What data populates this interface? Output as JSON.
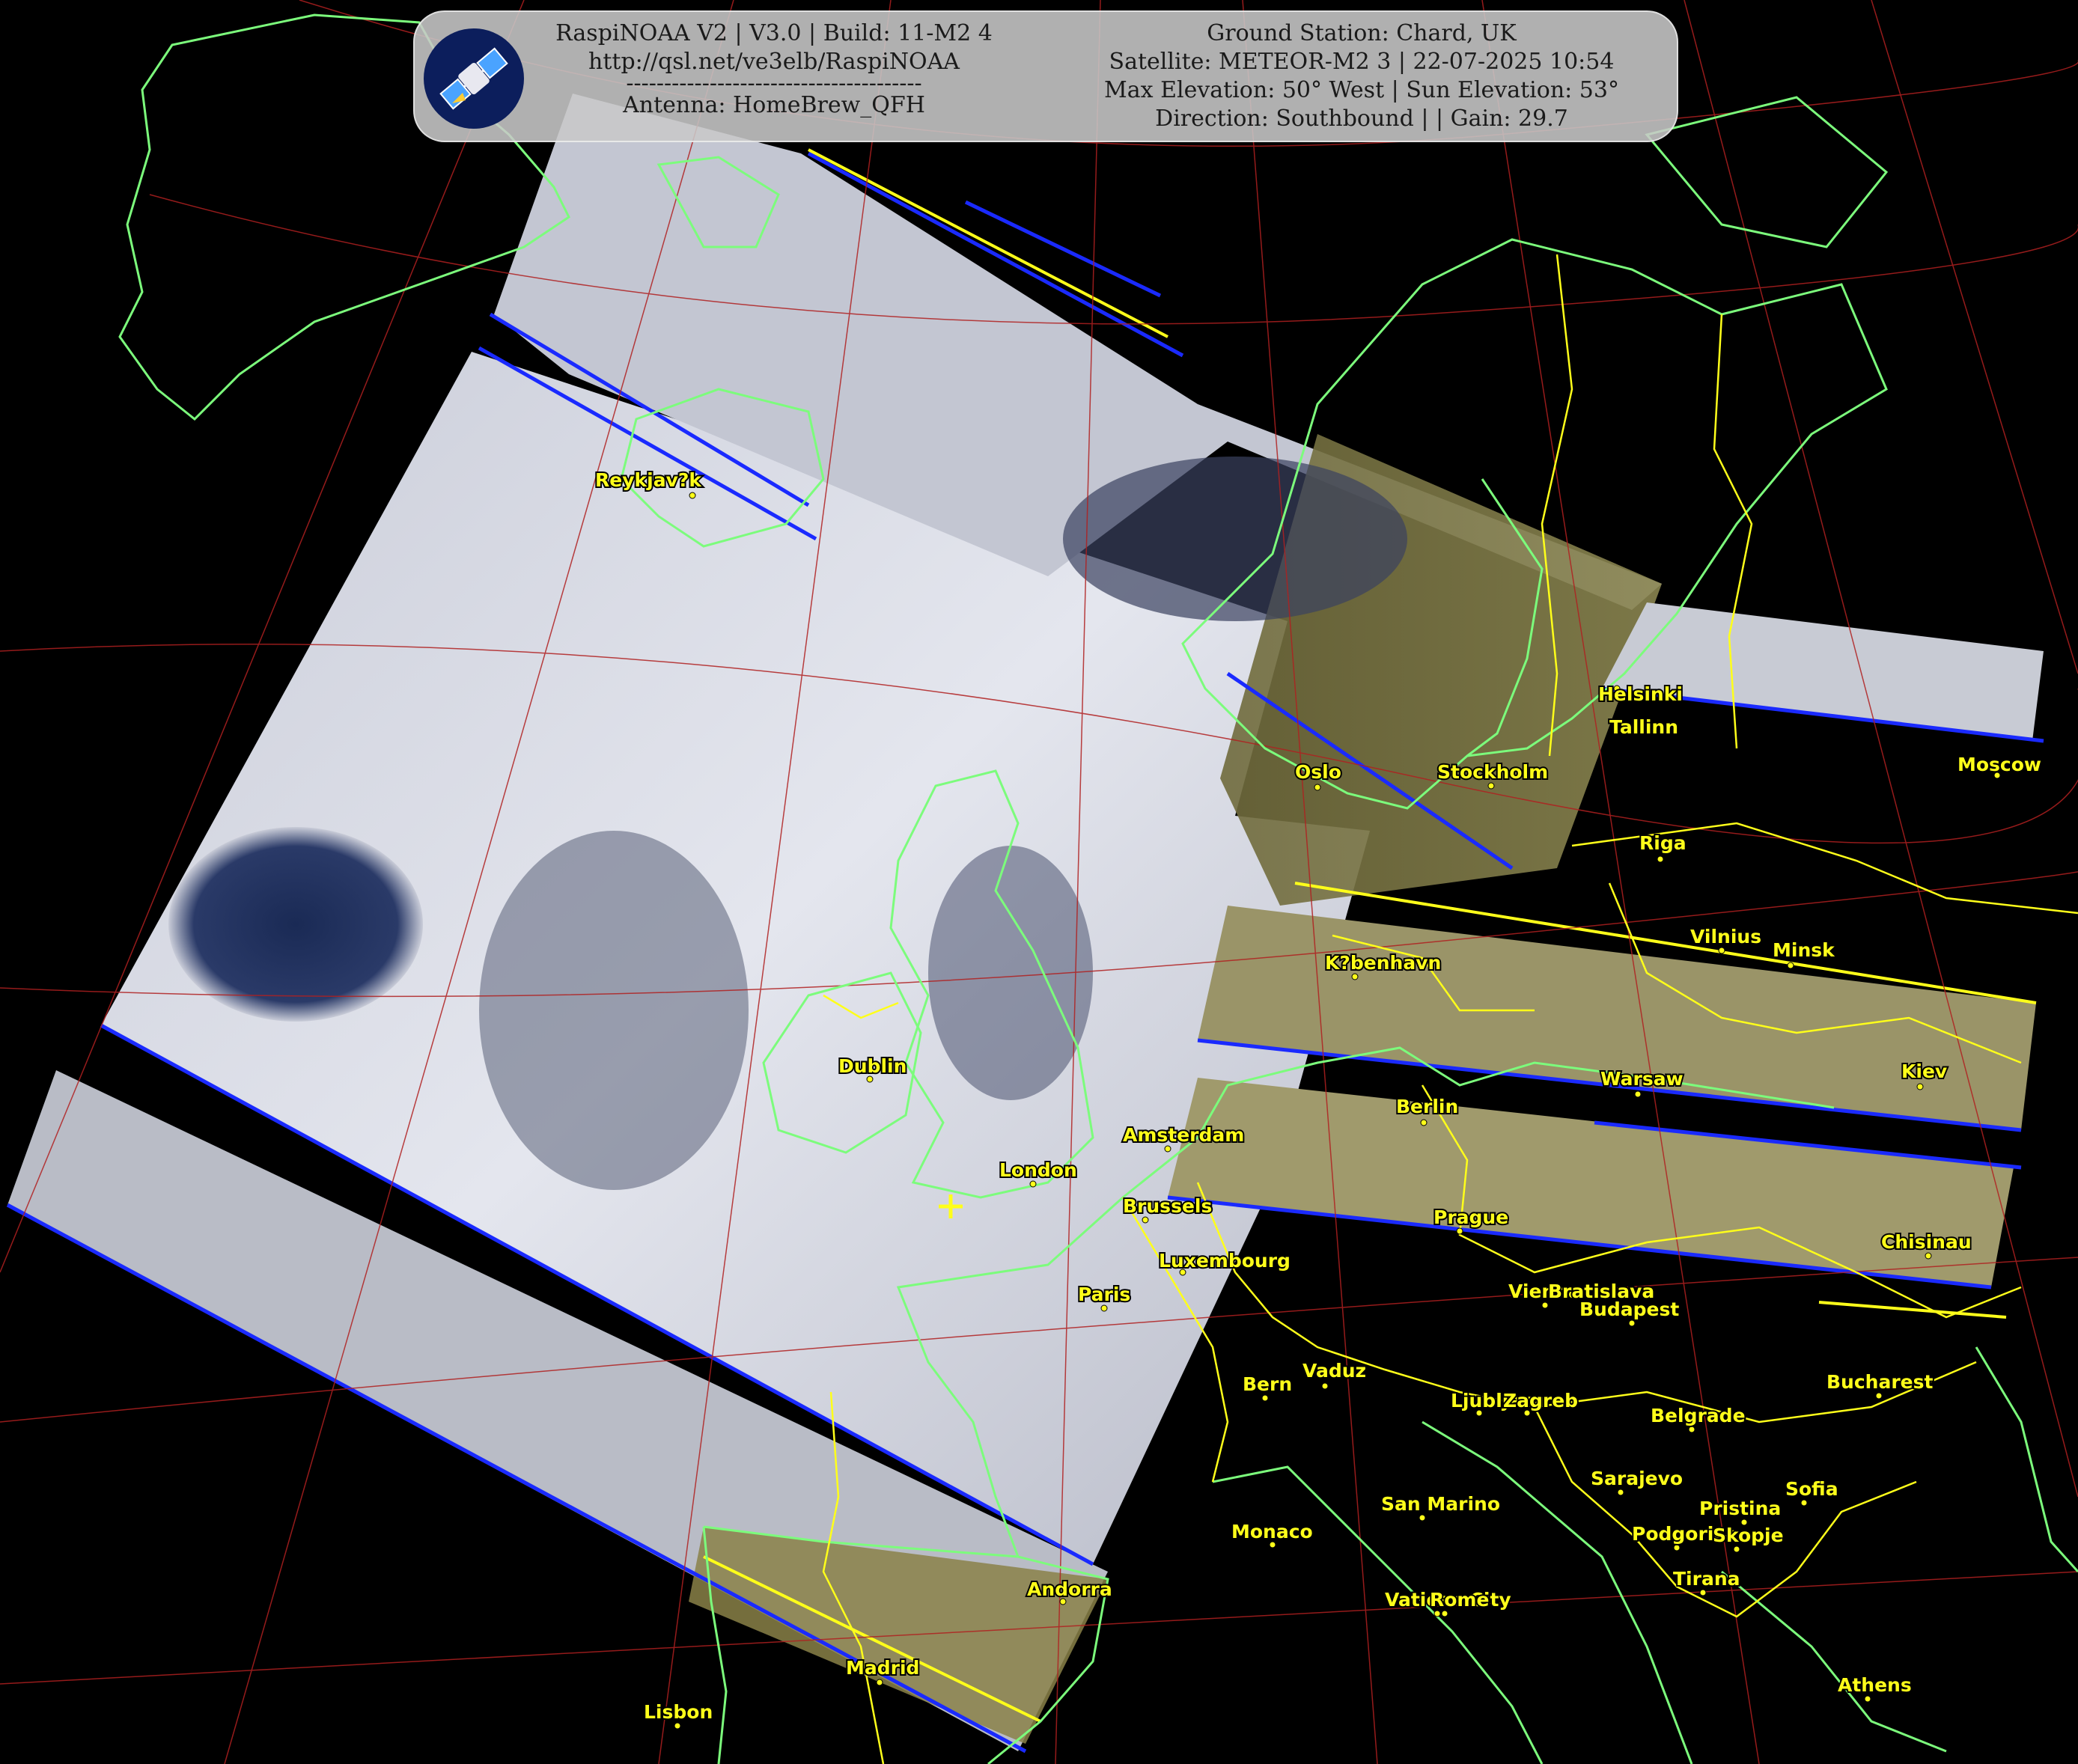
{
  "header": {
    "software": "RaspiNOAA V2 | V3.0 | Build: 11-M2 4",
    "url": "http://qsl.net/ve3elb/RaspiNOAA",
    "divider": "---------------------------------------",
    "antenna": "Antenna: HomeBrew_QFH",
    "ground_station": "Ground Station: Chard, UK",
    "satellite": "Satellite: METEOR-M2 3 | 22-07-2025 10:54",
    "elevation": "Max Elevation: 50° West | Sun Elevation: 53°",
    "direction": "Direction: Southbound | | Gain: 29.7",
    "logo_icon": "satellite-icon"
  },
  "colors": {
    "coastline": "#7CFC7C",
    "borders": "#ffff1a",
    "labels": "#ffff1a",
    "graticule": "#b02020",
    "scan_edge": "#1a2aff"
  },
  "cities": [
    {
      "name": "Reykjav?k"
    },
    {
      "name": "Helsinki"
    },
    {
      "name": "Tallinn"
    },
    {
      "name": "Oslo"
    },
    {
      "name": "Stockholm"
    },
    {
      "name": "Moscow"
    },
    {
      "name": "Riga"
    },
    {
      "name": "Vilnius"
    },
    {
      "name": "Minsk"
    },
    {
      "name": "K?benhavn"
    },
    {
      "name": "Dublin"
    },
    {
      "name": "Warsaw"
    },
    {
      "name": "Kiev"
    },
    {
      "name": "Berlin"
    },
    {
      "name": "Amsterdam"
    },
    {
      "name": "London"
    },
    {
      "name": "Brussels"
    },
    {
      "name": "Prague"
    },
    {
      "name": "Luxembourg"
    },
    {
      "name": "Chisinau"
    },
    {
      "name": "Paris"
    },
    {
      "name": "Vienna"
    },
    {
      "name": "Bratislava"
    },
    {
      "name": "Budapest"
    },
    {
      "name": "Bern"
    },
    {
      "name": "Vaduz"
    },
    {
      "name": "Ljubljana"
    },
    {
      "name": "Zagreb"
    },
    {
      "name": "Bucharest"
    },
    {
      "name": "Belgrade"
    },
    {
      "name": "Sarajevo"
    },
    {
      "name": "Sofia"
    },
    {
      "name": "Monaco"
    },
    {
      "name": "San Marino"
    },
    {
      "name": "Pristina"
    },
    {
      "name": "Podgorica"
    },
    {
      "name": "Skopje"
    },
    {
      "name": "Tirana"
    },
    {
      "name": "Andorra"
    },
    {
      "name": "Vatican City"
    },
    {
      "name": "Rome"
    },
    {
      "name": "Madrid"
    },
    {
      "name": "Athens"
    },
    {
      "name": "Lisbon"
    }
  ]
}
